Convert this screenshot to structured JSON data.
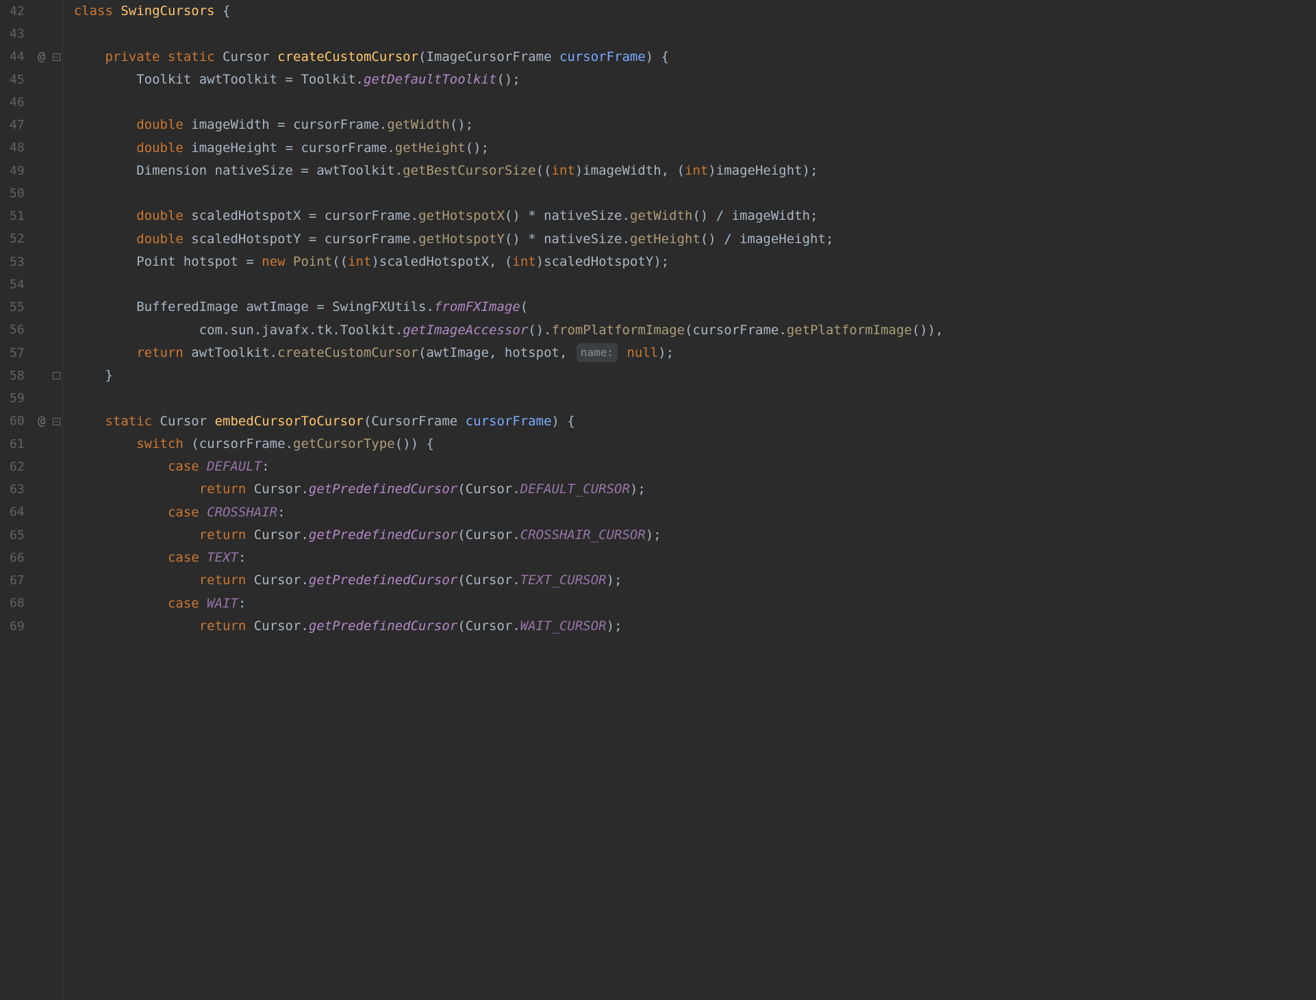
{
  "lines": [
    {
      "n": 42,
      "ann": "",
      "fold": "",
      "tokens": [
        {
          "t": "class ",
          "c": "kw"
        },
        {
          "t": "SwingCursors",
          "c": "class-yellow"
        },
        {
          "t": " {",
          "c": "pun"
        }
      ]
    },
    {
      "n": 43,
      "ann": "",
      "fold": "",
      "tokens": [
        {
          "t": "",
          "c": ""
        }
      ]
    },
    {
      "n": 44,
      "ann": "@",
      "fold": "open",
      "tokens": [
        {
          "t": "    ",
          "c": ""
        },
        {
          "t": "private static ",
          "c": "kw"
        },
        {
          "t": "Cursor ",
          "c": "cls"
        },
        {
          "t": "createCustomCursor",
          "c": "method-decl"
        },
        {
          "t": "(",
          "c": "pun"
        },
        {
          "t": "ImageCursorFrame ",
          "c": "cls"
        },
        {
          "t": "cursorFrame",
          "c": "param"
        },
        {
          "t": ") {",
          "c": "pun"
        }
      ]
    },
    {
      "n": 45,
      "ann": "",
      "fold": "",
      "tokens": [
        {
          "t": "        ",
          "c": ""
        },
        {
          "t": "Toolkit ",
          "c": "cls"
        },
        {
          "t": "awtToolkit",
          "c": "local"
        },
        {
          "t": " = ",
          "c": "op"
        },
        {
          "t": "Toolkit",
          "c": "cls"
        },
        {
          "t": ".",
          "c": "pun"
        },
        {
          "t": "getDefaultToolkit",
          "c": "static-call"
        },
        {
          "t": "();",
          "c": "pun"
        }
      ]
    },
    {
      "n": 46,
      "ann": "",
      "fold": "",
      "tokens": [
        {
          "t": "",
          "c": ""
        }
      ]
    },
    {
      "n": 47,
      "ann": "",
      "fold": "",
      "tokens": [
        {
          "t": "        ",
          "c": ""
        },
        {
          "t": "double ",
          "c": "kw"
        },
        {
          "t": "imageWidth",
          "c": "local"
        },
        {
          "t": " = ",
          "c": "op"
        },
        {
          "t": "cursorFrame",
          "c": "paramuse"
        },
        {
          "t": ".",
          "c": "pun"
        },
        {
          "t": "getWidth",
          "c": "call"
        },
        {
          "t": "();",
          "c": "pun"
        }
      ]
    },
    {
      "n": 48,
      "ann": "",
      "fold": "",
      "tokens": [
        {
          "t": "        ",
          "c": ""
        },
        {
          "t": "double ",
          "c": "kw"
        },
        {
          "t": "imageHeight",
          "c": "local"
        },
        {
          "t": " = ",
          "c": "op"
        },
        {
          "t": "cursorFrame",
          "c": "paramuse"
        },
        {
          "t": ".",
          "c": "pun"
        },
        {
          "t": "getHeight",
          "c": "call"
        },
        {
          "t": "();",
          "c": "pun"
        }
      ]
    },
    {
      "n": 49,
      "ann": "",
      "fold": "",
      "tokens": [
        {
          "t": "        ",
          "c": ""
        },
        {
          "t": "Dimension ",
          "c": "cls"
        },
        {
          "t": "nativeSize",
          "c": "local"
        },
        {
          "t": " = ",
          "c": "op"
        },
        {
          "t": "awtToolkit",
          "c": "local"
        },
        {
          "t": ".",
          "c": "pun"
        },
        {
          "t": "getBestCursorSize",
          "c": "call"
        },
        {
          "t": "((",
          "c": "pun"
        },
        {
          "t": "int",
          "c": "kw"
        },
        {
          "t": ")",
          "c": "pun"
        },
        {
          "t": "imageWidth",
          "c": "local"
        },
        {
          "t": ", (",
          "c": "pun"
        },
        {
          "t": "int",
          "c": "kw"
        },
        {
          "t": ")",
          "c": "pun"
        },
        {
          "t": "imageHeight",
          "c": "local"
        },
        {
          "t": ");",
          "c": "pun"
        }
      ]
    },
    {
      "n": 50,
      "ann": "",
      "fold": "",
      "tokens": [
        {
          "t": "",
          "c": ""
        }
      ]
    },
    {
      "n": 51,
      "ann": "",
      "fold": "",
      "tokens": [
        {
          "t": "        ",
          "c": ""
        },
        {
          "t": "double ",
          "c": "kw"
        },
        {
          "t": "scaledHotspotX",
          "c": "local"
        },
        {
          "t": " = ",
          "c": "op"
        },
        {
          "t": "cursorFrame",
          "c": "paramuse"
        },
        {
          "t": ".",
          "c": "pun"
        },
        {
          "t": "getHotspotX",
          "c": "call"
        },
        {
          "t": "() * ",
          "c": "pun"
        },
        {
          "t": "nativeSize",
          "c": "local"
        },
        {
          "t": ".",
          "c": "pun"
        },
        {
          "t": "getWidth",
          "c": "call"
        },
        {
          "t": "() / ",
          "c": "pun"
        },
        {
          "t": "imageWidth",
          "c": "local"
        },
        {
          "t": ";",
          "c": "pun"
        }
      ]
    },
    {
      "n": 52,
      "ann": "",
      "fold": "",
      "tokens": [
        {
          "t": "        ",
          "c": ""
        },
        {
          "t": "double ",
          "c": "kw"
        },
        {
          "t": "scaledHotspotY",
          "c": "local"
        },
        {
          "t": " = ",
          "c": "op"
        },
        {
          "t": "cursorFrame",
          "c": "paramuse"
        },
        {
          "t": ".",
          "c": "pun"
        },
        {
          "t": "getHotspotY",
          "c": "call"
        },
        {
          "t": "() * ",
          "c": "pun"
        },
        {
          "t": "nativeSize",
          "c": "local"
        },
        {
          "t": ".",
          "c": "pun"
        },
        {
          "t": "getHeight",
          "c": "call"
        },
        {
          "t": "() / ",
          "c": "pun"
        },
        {
          "t": "imageHeight",
          "c": "local"
        },
        {
          "t": ";",
          "c": "pun"
        }
      ]
    },
    {
      "n": 53,
      "ann": "",
      "fold": "",
      "tokens": [
        {
          "t": "        ",
          "c": ""
        },
        {
          "t": "Point ",
          "c": "cls"
        },
        {
          "t": "hotspot",
          "c": "local"
        },
        {
          "t": " = ",
          "c": "op"
        },
        {
          "t": "new ",
          "c": "kw"
        },
        {
          "t": "Point",
          "c": "call"
        },
        {
          "t": "((",
          "c": "pun"
        },
        {
          "t": "int",
          "c": "kw"
        },
        {
          "t": ")",
          "c": "pun"
        },
        {
          "t": "scaledHotspotX",
          "c": "local"
        },
        {
          "t": ", (",
          "c": "pun"
        },
        {
          "t": "int",
          "c": "kw"
        },
        {
          "t": ")",
          "c": "pun"
        },
        {
          "t": "scaledHotspotY",
          "c": "local"
        },
        {
          "t": ");",
          "c": "pun"
        }
      ]
    },
    {
      "n": 54,
      "ann": "",
      "fold": "",
      "tokens": [
        {
          "t": "",
          "c": ""
        }
      ]
    },
    {
      "n": 55,
      "ann": "",
      "fold": "",
      "tokens": [
        {
          "t": "        ",
          "c": ""
        },
        {
          "t": "BufferedImage ",
          "c": "cls"
        },
        {
          "t": "awtImage",
          "c": "local"
        },
        {
          "t": " = ",
          "c": "op"
        },
        {
          "t": "SwingFXUtils",
          "c": "cls"
        },
        {
          "t": ".",
          "c": "pun"
        },
        {
          "t": "fromFXImage",
          "c": "static-call"
        },
        {
          "t": "(",
          "c": "pun"
        }
      ]
    },
    {
      "n": 56,
      "ann": "",
      "fold": "",
      "tokens": [
        {
          "t": "                ",
          "c": ""
        },
        {
          "t": "com",
          "c": "local"
        },
        {
          "t": ".",
          "c": "pun"
        },
        {
          "t": "sun",
          "c": "local"
        },
        {
          "t": ".",
          "c": "pun"
        },
        {
          "t": "javafx",
          "c": "local"
        },
        {
          "t": ".",
          "c": "pun"
        },
        {
          "t": "tk",
          "c": "local"
        },
        {
          "t": ".",
          "c": "pun"
        },
        {
          "t": "Toolkit",
          "c": "cls"
        },
        {
          "t": ".",
          "c": "pun"
        },
        {
          "t": "getImageAccessor",
          "c": "static-call"
        },
        {
          "t": "().",
          "c": "pun"
        },
        {
          "t": "fromPlatformImage",
          "c": "call"
        },
        {
          "t": "(",
          "c": "pun"
        },
        {
          "t": "cursorFrame",
          "c": "paramuse"
        },
        {
          "t": ".",
          "c": "pun"
        },
        {
          "t": "getPlatformImage",
          "c": "call"
        },
        {
          "t": "()),",
          "c": "pun"
        }
      ]
    },
    {
      "n": 57,
      "ann": "",
      "fold": "",
      "tokens": [
        {
          "t": "        ",
          "c": ""
        },
        {
          "t": "return ",
          "c": "kw"
        },
        {
          "t": "awtToolkit",
          "c": "local"
        },
        {
          "t": ".",
          "c": "pun"
        },
        {
          "t": "createCustomCursor",
          "c": "call"
        },
        {
          "t": "(",
          "c": "pun"
        },
        {
          "t": "awtImage",
          "c": "local"
        },
        {
          "t": ", ",
          "c": "pun"
        },
        {
          "t": "hotspot",
          "c": "local"
        },
        {
          "t": ", ",
          "c": "pun"
        },
        {
          "t": "name:",
          "c": "hint"
        },
        {
          "t": " ",
          "c": ""
        },
        {
          "t": "null",
          "c": "kw"
        },
        {
          "t": ");",
          "c": "pun"
        }
      ]
    },
    {
      "n": 58,
      "ann": "",
      "fold": "close",
      "tokens": [
        {
          "t": "    }",
          "c": "pun"
        }
      ]
    },
    {
      "n": 59,
      "ann": "",
      "fold": "",
      "tokens": [
        {
          "t": "",
          "c": ""
        }
      ]
    },
    {
      "n": 60,
      "ann": "@",
      "fold": "open",
      "tokens": [
        {
          "t": "    ",
          "c": ""
        },
        {
          "t": "static ",
          "c": "kw"
        },
        {
          "t": "Cursor ",
          "c": "cls"
        },
        {
          "t": "embedCursorToCursor",
          "c": "method-decl"
        },
        {
          "t": "(",
          "c": "pun"
        },
        {
          "t": "CursorFrame ",
          "c": "cls"
        },
        {
          "t": "cursorFrame",
          "c": "param"
        },
        {
          "t": ") {",
          "c": "pun"
        }
      ]
    },
    {
      "n": 61,
      "ann": "",
      "fold": "",
      "tokens": [
        {
          "t": "        ",
          "c": ""
        },
        {
          "t": "switch ",
          "c": "kw"
        },
        {
          "t": "(",
          "c": "pun"
        },
        {
          "t": "cursorFrame",
          "c": "paramuse"
        },
        {
          "t": ".",
          "c": "pun"
        },
        {
          "t": "getCursorType",
          "c": "call"
        },
        {
          "t": "()) {",
          "c": "pun"
        }
      ]
    },
    {
      "n": 62,
      "ann": "",
      "fold": "",
      "tokens": [
        {
          "t": "            ",
          "c": ""
        },
        {
          "t": "case ",
          "c": "kw"
        },
        {
          "t": "DEFAULT",
          "c": "const"
        },
        {
          "t": ":",
          "c": "pun"
        }
      ]
    },
    {
      "n": 63,
      "ann": "",
      "fold": "",
      "tokens": [
        {
          "t": "                ",
          "c": ""
        },
        {
          "t": "return ",
          "c": "kw"
        },
        {
          "t": "Cursor",
          "c": "cls"
        },
        {
          "t": ".",
          "c": "pun"
        },
        {
          "t": "getPredefinedCursor",
          "c": "static-call"
        },
        {
          "t": "(",
          "c": "pun"
        },
        {
          "t": "Cursor",
          "c": "cls"
        },
        {
          "t": ".",
          "c": "pun"
        },
        {
          "t": "DEFAULT_CURSOR",
          "c": "const"
        },
        {
          "t": ");",
          "c": "pun"
        }
      ]
    },
    {
      "n": 64,
      "ann": "",
      "fold": "",
      "tokens": [
        {
          "t": "            ",
          "c": ""
        },
        {
          "t": "case ",
          "c": "kw"
        },
        {
          "t": "CROSSHAIR",
          "c": "const"
        },
        {
          "t": ":",
          "c": "pun"
        }
      ]
    },
    {
      "n": 65,
      "ann": "",
      "fold": "",
      "tokens": [
        {
          "t": "                ",
          "c": ""
        },
        {
          "t": "return ",
          "c": "kw"
        },
        {
          "t": "Cursor",
          "c": "cls"
        },
        {
          "t": ".",
          "c": "pun"
        },
        {
          "t": "getPredefinedCursor",
          "c": "static-call"
        },
        {
          "t": "(",
          "c": "pun"
        },
        {
          "t": "Cursor",
          "c": "cls"
        },
        {
          "t": ".",
          "c": "pun"
        },
        {
          "t": "CROSSHAIR_CURSOR",
          "c": "const"
        },
        {
          "t": ");",
          "c": "pun"
        }
      ]
    },
    {
      "n": 66,
      "ann": "",
      "fold": "",
      "tokens": [
        {
          "t": "            ",
          "c": ""
        },
        {
          "t": "case ",
          "c": "kw"
        },
        {
          "t": "TEXT",
          "c": "const"
        },
        {
          "t": ":",
          "c": "pun"
        }
      ]
    },
    {
      "n": 67,
      "ann": "",
      "fold": "",
      "tokens": [
        {
          "t": "                ",
          "c": ""
        },
        {
          "t": "return ",
          "c": "kw"
        },
        {
          "t": "Cursor",
          "c": "cls"
        },
        {
          "t": ".",
          "c": "pun"
        },
        {
          "t": "getPredefinedCursor",
          "c": "static-call"
        },
        {
          "t": "(",
          "c": "pun"
        },
        {
          "t": "Cursor",
          "c": "cls"
        },
        {
          "t": ".",
          "c": "pun"
        },
        {
          "t": "TEXT_CURSOR",
          "c": "const"
        },
        {
          "t": ");",
          "c": "pun"
        }
      ]
    },
    {
      "n": 68,
      "ann": "",
      "fold": "",
      "tokens": [
        {
          "t": "            ",
          "c": ""
        },
        {
          "t": "case ",
          "c": "kw"
        },
        {
          "t": "WAIT",
          "c": "const"
        },
        {
          "t": ":",
          "c": "pun"
        }
      ]
    },
    {
      "n": 69,
      "ann": "",
      "fold": "",
      "tokens": [
        {
          "t": "                ",
          "c": ""
        },
        {
          "t": "return ",
          "c": "kw"
        },
        {
          "t": "Cursor",
          "c": "cls"
        },
        {
          "t": ".",
          "c": "pun"
        },
        {
          "t": "getPredefinedCursor",
          "c": "static-call"
        },
        {
          "t": "(",
          "c": "pun"
        },
        {
          "t": "Cursor",
          "c": "cls"
        },
        {
          "t": ".",
          "c": "pun"
        },
        {
          "t": "WAIT_CURSOR",
          "c": "const"
        },
        {
          "t": ");",
          "c": "pun"
        }
      ]
    }
  ]
}
